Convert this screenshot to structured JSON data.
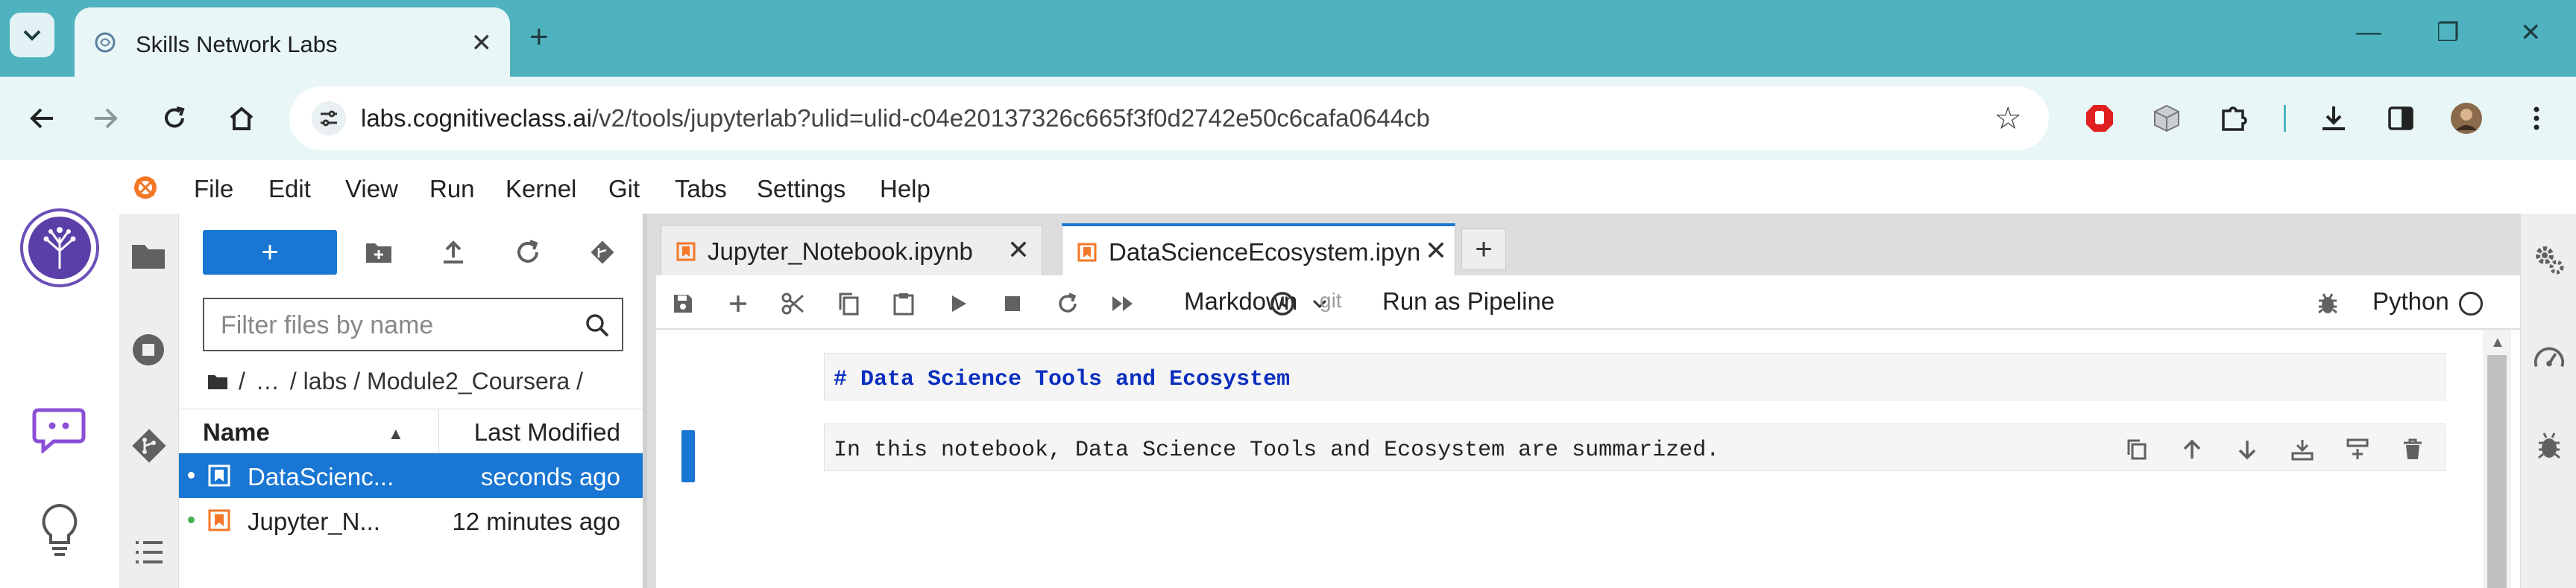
{
  "browser": {
    "tab_title": "Skills Network Labs",
    "tab_close": "✕",
    "new_tab": "+",
    "url_host": "labs.cognitiveclass.ai",
    "url_path": "/v2/tools/jupyterlab?ulid=ulid-c04e20137326c665f3f0d2742e50c6cafa0644cb",
    "colors": {
      "frame": "#4fb3bf",
      "toolbar": "#e8f6f7"
    }
  },
  "menubar": {
    "items": [
      "File",
      "Edit",
      "View",
      "Run",
      "Kernel",
      "Git",
      "Tabs",
      "Settings",
      "Help"
    ]
  },
  "filebrowser": {
    "new_button": "+",
    "filter_placeholder": "Filter files by name",
    "breadcrumbs": [
      "/",
      "…",
      "/ labs / Module2_Coursera /"
    ],
    "col_name": "Name",
    "col_modified": "Last Modified",
    "files": [
      {
        "name": "DataScienc...",
        "modified": "seconds ago",
        "selected": true
      },
      {
        "name": "Jupyter_N...",
        "modified": "12 minutes ago",
        "selected": false
      }
    ]
  },
  "doc_tabs": [
    {
      "title": "Jupyter_Notebook.ipynb",
      "active": false
    },
    {
      "title": "DataScienceEcosystem.ipyn",
      "active": true
    }
  ],
  "doc_tab_close": "✕",
  "doc_add": "+",
  "notebook_toolbar": {
    "cell_type": "Markdown",
    "git": "git",
    "pipeline": "Run as Pipeline",
    "kernel": "Python"
  },
  "cells": [
    {
      "source": "# Data Science Tools and Ecosystem",
      "color": "#0b2fbf",
      "bold": true
    },
    {
      "source": "In this notebook, Data Science Tools and Ecosystem are summarized.",
      "color": "#222222",
      "bold": false
    }
  ],
  "accent": "#1976d2"
}
